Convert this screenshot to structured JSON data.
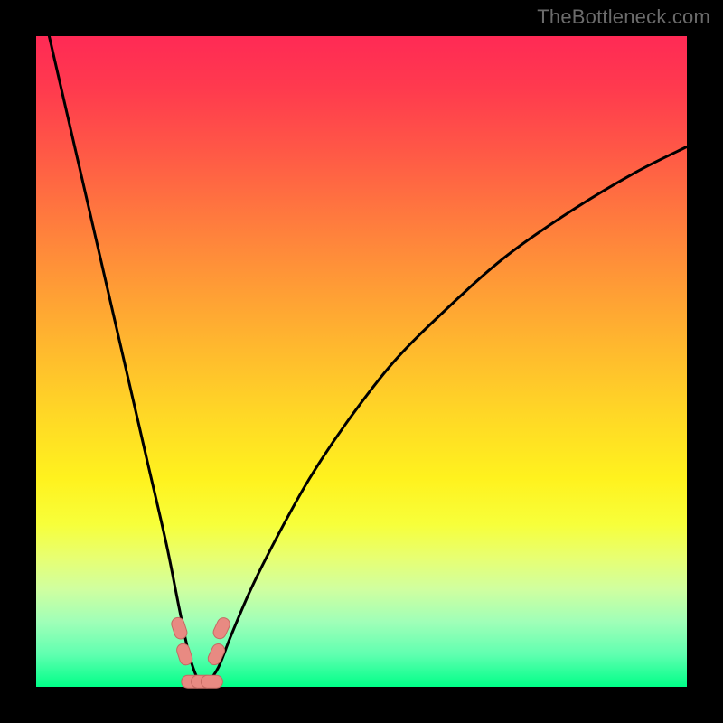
{
  "watermark": "TheBottleneck.com",
  "chart_data": {
    "type": "line",
    "title": "",
    "xlabel": "",
    "ylabel": "",
    "xlim": [
      0,
      100
    ],
    "ylim": [
      0,
      100
    ],
    "grid": false,
    "series": [
      {
        "name": "bottleneck-curve",
        "x": [
          2,
          5,
          8,
          11,
          14,
          17,
          20,
          22,
          23.5,
          25,
          26.5,
          28,
          30,
          33,
          37,
          42,
          48,
          55,
          63,
          72,
          82,
          92,
          100
        ],
        "values": [
          100,
          87,
          74,
          61,
          48,
          35,
          22,
          12,
          5,
          1,
          1,
          3,
          8,
          15,
          23,
          32,
          41,
          50,
          58,
          66,
          73,
          79,
          83
        ]
      }
    ],
    "markers": [
      {
        "name": "marker-left-upper",
        "x": 22.0,
        "y": 9.0
      },
      {
        "name": "marker-left-lower",
        "x": 22.8,
        "y": 5.0
      },
      {
        "name": "marker-right-upper",
        "x": 28.5,
        "y": 9.0
      },
      {
        "name": "marker-right-lower",
        "x": 27.7,
        "y": 5.0
      },
      {
        "name": "marker-bottom-a",
        "x": 24.0,
        "y": 0.8
      },
      {
        "name": "marker-bottom-b",
        "x": 25.5,
        "y": 0.8
      },
      {
        "name": "marker-bottom-c",
        "x": 27.0,
        "y": 0.8
      }
    ],
    "colors": {
      "curve": "#000000",
      "marker_fill": "#e88a82",
      "marker_stroke": "#c46a62"
    }
  }
}
